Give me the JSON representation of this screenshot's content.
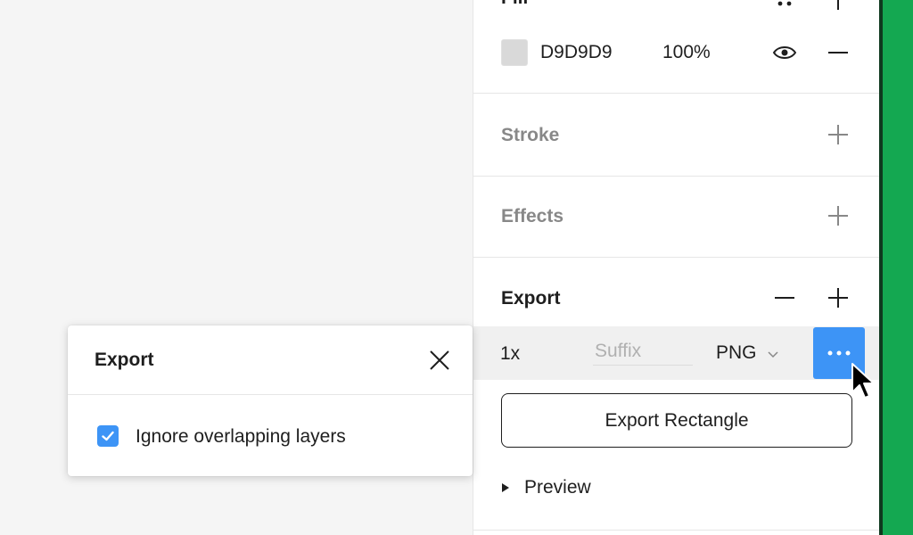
{
  "fill": {
    "title": "Fill",
    "color_hex": "D9D9D9",
    "swatch_color": "#D9D9D9",
    "opacity": "100%"
  },
  "stroke": {
    "title": "Stroke"
  },
  "effects": {
    "title": "Effects"
  },
  "export": {
    "title": "Export",
    "scale": "1x",
    "suffix_placeholder": "Suffix",
    "suffix_value": "",
    "format": "PNG",
    "button_label": "Export Rectangle",
    "preview_label": "Preview"
  },
  "popover": {
    "title": "Export",
    "checkbox_label": "Ignore overlapping layers",
    "checkbox_checked": true
  },
  "colors": {
    "accent": "#3D94F6",
    "sidebar_edge": "#14A851"
  }
}
